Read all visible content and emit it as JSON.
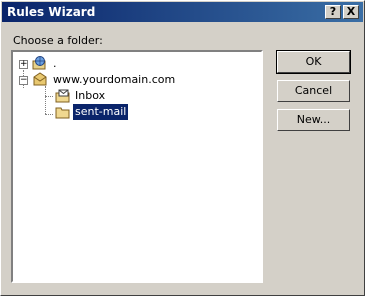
{
  "window": {
    "title": "Rules Wizard",
    "help_glyph": "?",
    "close_glyph": "X"
  },
  "tree": {
    "label": "Choose a folder:",
    "nodes": [
      {
        "label": ".",
        "expander": "+",
        "icon": "globe-folder-icon"
      },
      {
        "label": "www.yourdomain.com",
        "expander": "−",
        "icon": "mailbox-icon"
      },
      {
        "label": "Inbox",
        "icon": "inbox-folder-icon"
      },
      {
        "label": "sent-mail",
        "icon": "folder-icon",
        "selected": true
      }
    ]
  },
  "buttons": {
    "ok": "OK",
    "cancel": "Cancel",
    "new": "New..."
  },
  "colors": {
    "titlebar": "#0a246a",
    "selection": "#0a246a",
    "face": "#d4d0c8"
  }
}
